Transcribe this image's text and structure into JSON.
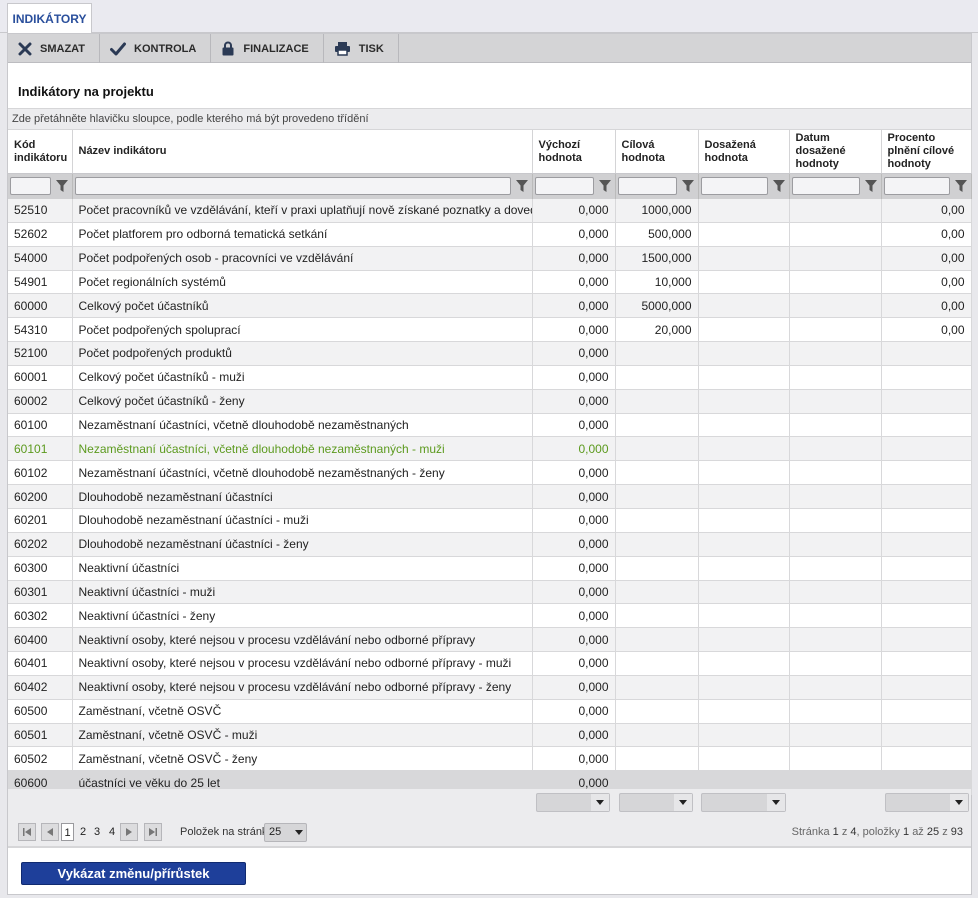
{
  "tab": {
    "label": "INDIKÁTORY"
  },
  "toolbar": {
    "delete_label": "SMAZAT",
    "check_label": "KONTROLA",
    "finalize_label": "FINALIZACE",
    "print_label": "TISK"
  },
  "section": {
    "title": "Indikátory na projektu"
  },
  "grid": {
    "group_hint": "Zde přetáhněte hlavičku sloupce, podle kterého má být provedeno třídění",
    "columns": {
      "code": "Kód indikátoru",
      "name": "Název indikátoru",
      "start": "Výchozí hodnota",
      "target": "Cílová hodnota",
      "achieved": "Dosažená hodnota",
      "date": "Datum dosažené hodnoty",
      "percent": "Procento plnění cílové hodnoty"
    },
    "rows": [
      {
        "code": "52510",
        "name": "Počet pracovníků ve vzdělávání, kteří v praxi uplatňují nově získané poznatky a dovednosti",
        "start": "0,000",
        "target": "1000,000",
        "achieved": "",
        "date": "",
        "percent": "0,00"
      },
      {
        "code": "52602",
        "name": "Počet platforem pro odborná tematická setkání",
        "start": "0,000",
        "target": "500,000",
        "achieved": "",
        "date": "",
        "percent": "0,00"
      },
      {
        "code": "54000",
        "name": "Počet podpořených osob - pracovníci ve vzdělávání",
        "start": "0,000",
        "target": "1500,000",
        "achieved": "",
        "date": "",
        "percent": "0,00"
      },
      {
        "code": "54901",
        "name": "Počet regionálních systémů",
        "start": "0,000",
        "target": "10,000",
        "achieved": "",
        "date": "",
        "percent": "0,00"
      },
      {
        "code": "60000",
        "name": "Celkový počet účastníků",
        "start": "0,000",
        "target": "5000,000",
        "achieved": "",
        "date": "",
        "percent": "0,00"
      },
      {
        "code": "54310",
        "name": "Počet podpořených spoluprací",
        "start": "0,000",
        "target": "20,000",
        "achieved": "",
        "date": "",
        "percent": "0,00"
      },
      {
        "code": "52100",
        "name": "Počet podpořených produktů",
        "start": "0,000",
        "target": "",
        "achieved": "",
        "date": "",
        "percent": ""
      },
      {
        "code": "60001",
        "name": "Celkový počet účastníků - muži",
        "start": "0,000",
        "target": "",
        "achieved": "",
        "date": "",
        "percent": ""
      },
      {
        "code": "60002",
        "name": "Celkový počet účastníků - ženy",
        "start": "0,000",
        "target": "",
        "achieved": "",
        "date": "",
        "percent": ""
      },
      {
        "code": "60100",
        "name": "Nezaměstnaní účastníci, včetně dlouhodobě nezaměstnaných",
        "start": "0,000",
        "target": "",
        "achieved": "",
        "date": "",
        "percent": ""
      },
      {
        "code": "60101",
        "name": "Nezaměstnaní účastníci, včetně dlouhodobě nezaměstnaných - muži",
        "start": "0,000",
        "target": "",
        "achieved": "",
        "date": "",
        "percent": "",
        "highlight": true
      },
      {
        "code": "60102",
        "name": "Nezaměstnaní účastníci, včetně dlouhodobě nezaměstnaných - ženy",
        "start": "0,000",
        "target": "",
        "achieved": "",
        "date": "",
        "percent": ""
      },
      {
        "code": "60200",
        "name": "Dlouhodobě nezaměstnaní účastníci",
        "start": "0,000",
        "target": "",
        "achieved": "",
        "date": "",
        "percent": ""
      },
      {
        "code": "60201",
        "name": "Dlouhodobě nezaměstnaní účastníci - muži",
        "start": "0,000",
        "target": "",
        "achieved": "",
        "date": "",
        "percent": ""
      },
      {
        "code": "60202",
        "name": "Dlouhodobě nezaměstnaní účastníci - ženy",
        "start": "0,000",
        "target": "",
        "achieved": "",
        "date": "",
        "percent": ""
      },
      {
        "code": "60300",
        "name": "Neaktivní účastníci",
        "start": "0,000",
        "target": "",
        "achieved": "",
        "date": "",
        "percent": ""
      },
      {
        "code": "60301",
        "name": "Neaktivní účastníci - muži",
        "start": "0,000",
        "target": "",
        "achieved": "",
        "date": "",
        "percent": ""
      },
      {
        "code": "60302",
        "name": "Neaktivní účastníci - ženy",
        "start": "0,000",
        "target": "",
        "achieved": "",
        "date": "",
        "percent": ""
      },
      {
        "code": "60400",
        "name": "Neaktivní osoby, které nejsou v procesu vzdělávání nebo odborné přípravy",
        "start": "0,000",
        "target": "",
        "achieved": "",
        "date": "",
        "percent": ""
      },
      {
        "code": "60401",
        "name": "Neaktivní osoby, které nejsou v procesu vzdělávání nebo odborné přípravy - muži",
        "start": "0,000",
        "target": "",
        "achieved": "",
        "date": "",
        "percent": ""
      },
      {
        "code": "60402",
        "name": "Neaktivní osoby, které nejsou v procesu vzdělávání nebo odborné přípravy - ženy",
        "start": "0,000",
        "target": "",
        "achieved": "",
        "date": "",
        "percent": ""
      },
      {
        "code": "60500",
        "name": "Zaměstnaní, včetně OSVČ",
        "start": "0,000",
        "target": "",
        "achieved": "",
        "date": "",
        "percent": ""
      },
      {
        "code": "60501",
        "name": "Zaměstnaní, včetně OSVČ - muži",
        "start": "0,000",
        "target": "",
        "achieved": "",
        "date": "",
        "percent": ""
      },
      {
        "code": "60502",
        "name": "Zaměstnaní, včetně OSVČ - ženy",
        "start": "0,000",
        "target": "",
        "achieved": "",
        "date": "",
        "percent": ""
      },
      {
        "code": "60600",
        "name": "účastníci ve věku do 25 let",
        "start": "0,000",
        "target": "",
        "achieved": "",
        "date": "",
        "percent": "",
        "selected": true
      }
    ]
  },
  "pager": {
    "pages": [
      "1",
      "2",
      "3",
      "4"
    ],
    "current_page": "1",
    "per_page_label": "Položek na stránku",
    "per_page_value": "25",
    "info_prefix": "Stránka",
    "info_page": "1",
    "info_of": "z",
    "info_pages": "4",
    "info_items": ", položky",
    "info_from": "1",
    "info_to_word": "až",
    "info_to": "25",
    "info_total_word": "z",
    "info_total": "93"
  },
  "actions": {
    "report_change_label": "Vykázat změnu/přírůstek"
  },
  "colors": {
    "accent": "#1e3f9a",
    "tab_text": "#2a4f9c",
    "highlight_row": "#5c9a1e"
  },
  "icons": [
    "delete-x-icon",
    "check-icon",
    "lock-icon",
    "printer-icon",
    "filter-icon",
    "first-page-icon",
    "prev-page-icon",
    "next-page-icon",
    "last-page-icon",
    "chevron-down-icon"
  ]
}
